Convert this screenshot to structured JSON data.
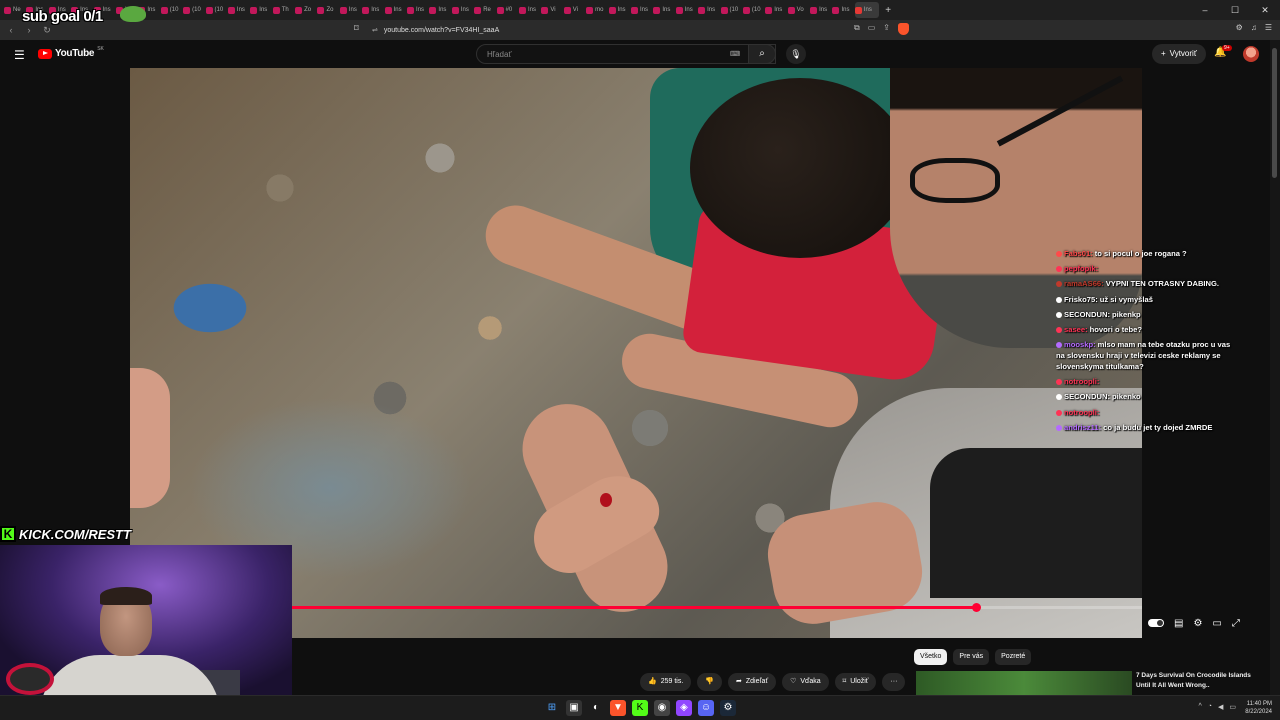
{
  "browser": {
    "tabs": [
      "Ne",
      "Ins",
      "Ins",
      "Ins",
      "Ins",
      "Ins",
      "Ins",
      "(10",
      "(10",
      "(10",
      "Ins",
      "Ins",
      "Th",
      "Zo",
      "Zo",
      "Ins",
      "Ins",
      "Ins",
      "Ins",
      "Ins",
      "Ins",
      "Re",
      "#0",
      "Ins",
      "Vi",
      "Vi",
      "mo",
      "Ins",
      "Ins",
      "Ins",
      "Ins",
      "Ins",
      "(10",
      "(10",
      "Ins",
      "Vo",
      "Ins",
      "Ins",
      "Ins"
    ],
    "new_tab": "+",
    "url": "youtube.com/watch?v=FV34HI_saaA",
    "window_controls": [
      "–",
      "☐",
      "✕"
    ]
  },
  "youtube": {
    "logo_text": "YouTube",
    "region": "SK",
    "search_placeholder": "Hľadať",
    "create_label": "Vytvoriť",
    "notifications": "9+"
  },
  "overlay": {
    "sub_goal": "sub goal 0/1",
    "kick_text": "KICK.COM/RESTT",
    "kick_k": "K"
  },
  "chat": [
    {
      "user": "Fabs01:",
      "text": "to si pocul o joe rogana ?",
      "color": "#ff4a4a"
    },
    {
      "user": "pepfopik:",
      "text": "",
      "color": "#ff3355"
    },
    {
      "user": "ramaAS66:",
      "text": "VYPNI TEN OTRASNY DABING.",
      "color": "#c0392b"
    },
    {
      "user": "Frisko75:",
      "text": "už si vymyšlaš",
      "color": "#ffffff"
    },
    {
      "user": "SECONDUN:",
      "text": "pikenkp",
      "color": "#ffffff"
    },
    {
      "user": "sasee:",
      "text": "hovori o tebe?",
      "color": "#ff3355"
    },
    {
      "user": "mooskp:",
      "text": "mlso mam na tebe otazku proc u vas na slovensku hraji v televizi ceske reklamy se slovenskyma titulkama?",
      "color": "#b46bff"
    },
    {
      "user": "notroopli:",
      "text": "",
      "color": "#ff3355"
    },
    {
      "user": "SECONDUN:",
      "text": "pikenko",
      "color": "#ffffff"
    },
    {
      "user": "notroopli:",
      "text": "",
      "color": "#ff3355"
    },
    {
      "user": "andrisz11:",
      "text": "co ja budu jet ty dojed ZMRDE",
      "color": "#b46bff"
    }
  ],
  "player": {
    "progress": 0.805
  },
  "below": {
    "chips": [
      "Všetko",
      "Pre vás",
      "Pozreté"
    ],
    "likes": "259 tis.",
    "share": "Zdieľať",
    "clip": "Vďaka",
    "save": "Uložiť",
    "more": "···",
    "rec_title": "7 Days Survival On Crocodile Islands Until It All Went Wrong.."
  },
  "taskbar": {
    "time": "11:40 PM",
    "date": "8/22/2024"
  }
}
